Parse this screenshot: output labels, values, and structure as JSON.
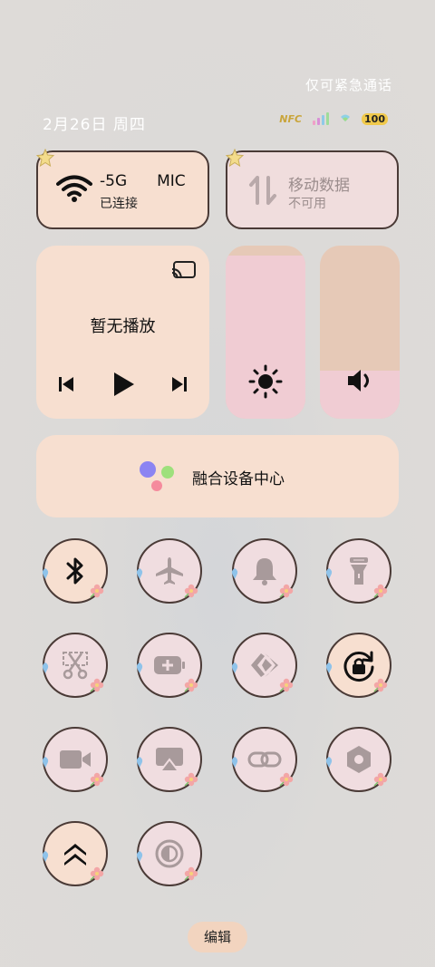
{
  "status_bar": {
    "emergency_text": "仅可紧急通话",
    "date": "2月26日 周四",
    "nfc_label": "NFC",
    "battery_level": "100"
  },
  "wifi": {
    "name": "-5G",
    "name_suffix": "MIC",
    "status": "已连接"
  },
  "mobile_data": {
    "name": "移动数据",
    "status": "不可用"
  },
  "media": {
    "title": "暂无播放"
  },
  "sliders": {
    "brightness_level": 0.94,
    "volume_level": 0.28
  },
  "device_hub": {
    "label": "融合设备中心"
  },
  "tiles": [
    {
      "name": "bluetooth",
      "icon": "bluetooth-icon",
      "active": true
    },
    {
      "name": "airplane-mode",
      "icon": "airplane-icon",
      "active": false
    },
    {
      "name": "ring-mode",
      "icon": "bell-icon",
      "active": false
    },
    {
      "name": "flashlight",
      "icon": "flashlight-icon",
      "active": false
    },
    {
      "name": "screenshot",
      "icon": "scissors-icon",
      "active": false
    },
    {
      "name": "power-saving",
      "icon": "battery-plus-icon",
      "active": false
    },
    {
      "name": "share",
      "icon": "share-icon",
      "active": false
    },
    {
      "name": "rotation-lock",
      "icon": "rotation-lock-icon",
      "active": true
    },
    {
      "name": "screen-record",
      "icon": "video-camera-icon",
      "active": false
    },
    {
      "name": "screen-cast",
      "icon": "airplay-icon",
      "active": false
    },
    {
      "name": "link",
      "icon": "link-icon",
      "active": false
    },
    {
      "name": "nfc-settings",
      "icon": "hexagon-icon",
      "active": false
    },
    {
      "name": "performance",
      "icon": "double-chevron-up-icon",
      "active": true
    },
    {
      "name": "eye-comfort",
      "icon": "contrast-icon",
      "active": false
    }
  ],
  "edit_label": "编辑"
}
